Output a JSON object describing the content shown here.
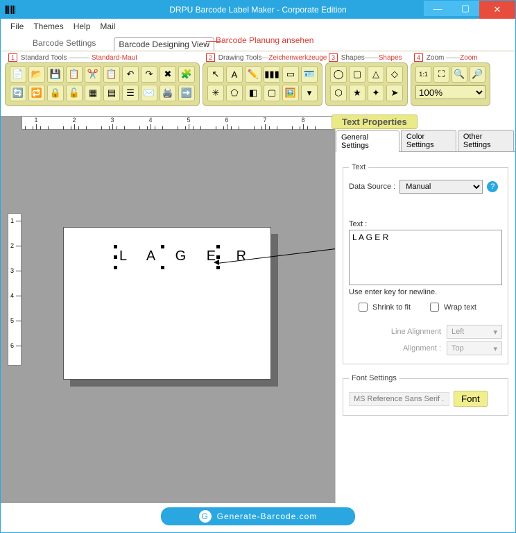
{
  "title": "DRPU Barcode Label Maker - Corporate Edition",
  "menu": {
    "file": "File",
    "themes": "Themes",
    "help": "Help",
    "mail": "Mail"
  },
  "annotations": {
    "barcode_view": "Barcode Planung ansehen",
    "standard": {
      "num": "1",
      "en": "Standard Tools",
      "de": "Standard-Maut"
    },
    "drawing": {
      "num": "2",
      "en": "Drawing Tools",
      "de": "Zeichenwerkzeuge"
    },
    "shapes": {
      "num": "3",
      "en": "Shapes",
      "de": "Shapes"
    },
    "zoom": {
      "num": "4",
      "en": "Zoom",
      "de": "Zoom"
    }
  },
  "maintabs": {
    "settings": "Barcode Settings",
    "designing": "Barcode Designing View"
  },
  "zoom": {
    "value": "100%"
  },
  "rulerH": [
    "1",
    "2",
    "3",
    "4",
    "5",
    "6",
    "7",
    "8"
  ],
  "rulerV": [
    "1",
    "2",
    "3",
    "4",
    "5",
    "6"
  ],
  "canvas_text": "L A G E R",
  "panel": {
    "title": "Text Properties",
    "tabs": {
      "general": "General Settings",
      "color": "Color Settings",
      "other": "Other Settings"
    },
    "text_legend": "Text",
    "datasource_label": "Data Source :",
    "datasource_value": "Manual",
    "text_label": "Text :",
    "text_value": "L A G E R",
    "hint": "Use enter key for newline.",
    "shrink": "Shrink to fit",
    "wrap": "Wrap text",
    "line_align_l": "Line Alignment",
    "line_align_v": "Left",
    "align_l": "Alignment :",
    "align_v": "Top",
    "fontset_legend": "Font Settings",
    "font_name": "MS Reference Sans Serif .",
    "font_btn": "Font"
  },
  "footer": "Generate-Barcode.com",
  "win": {
    "min": "—",
    "max": "▢",
    "close": "✕"
  }
}
